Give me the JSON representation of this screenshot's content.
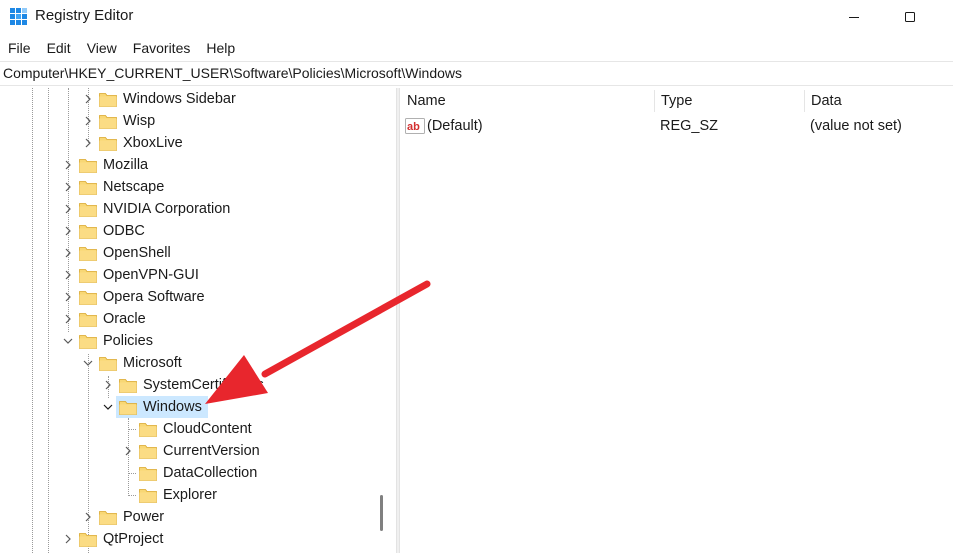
{
  "window": {
    "title": "Registry Editor"
  },
  "menu": [
    "File",
    "Edit",
    "View",
    "Favorites",
    "Help"
  ],
  "address": {
    "path": "Computer\\HKEY_CURRENT_USER\\Software\\Policies\\Microsoft\\Windows"
  },
  "tree": {
    "items": [
      {
        "label": "Windows Sidebar",
        "expander": "collapsed",
        "selected": false
      },
      {
        "label": "Wisp",
        "expander": "collapsed",
        "selected": false
      },
      {
        "label": "XboxLive",
        "expander": "collapsed",
        "selected": false
      },
      {
        "label": "Mozilla",
        "expander": "collapsed",
        "selected": false
      },
      {
        "label": "Netscape",
        "expander": "collapsed",
        "selected": false
      },
      {
        "label": "NVIDIA Corporation",
        "expander": "collapsed",
        "selected": false
      },
      {
        "label": "ODBC",
        "expander": "collapsed",
        "selected": false
      },
      {
        "label": "OpenShell",
        "expander": "collapsed",
        "selected": false
      },
      {
        "label": "OpenVPN-GUI",
        "expander": "collapsed",
        "selected": false
      },
      {
        "label": "Opera Software",
        "expander": "collapsed",
        "selected": false
      },
      {
        "label": "Oracle",
        "expander": "collapsed",
        "selected": false
      },
      {
        "label": "Policies",
        "expander": "expanded",
        "selected": false
      },
      {
        "label": "Microsoft",
        "expander": "expanded",
        "selected": false
      },
      {
        "label": "SystemCertificates",
        "expander": "collapsed",
        "selected": false
      },
      {
        "label": "Windows",
        "expander": "expanded",
        "selected": true
      },
      {
        "label": "CloudContent",
        "expander": "none",
        "selected": false
      },
      {
        "label": "CurrentVersion",
        "expander": "collapsed",
        "selected": false
      },
      {
        "label": "DataCollection",
        "expander": "none",
        "selected": false
      },
      {
        "label": "Explorer",
        "expander": "none",
        "selected": false
      },
      {
        "label": "Power",
        "expander": "collapsed",
        "selected": false
      },
      {
        "label": "QtProject",
        "expander": "collapsed",
        "selected": false
      }
    ]
  },
  "list": {
    "columns": [
      "Name",
      "Type",
      "Data"
    ],
    "rows": [
      {
        "name": "(Default)",
        "type": "REG_SZ",
        "data": "(value not set)",
        "icon": "string-value-icon"
      }
    ]
  },
  "colors": {
    "selection": "#cce8ff",
    "folder": "#f8d775",
    "arrow": "#e8262d"
  }
}
